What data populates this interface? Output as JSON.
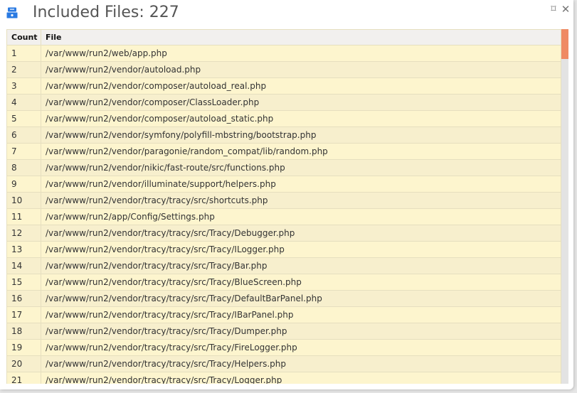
{
  "panel": {
    "title": "Included Files: 227",
    "icon": "file-cabinet-icon",
    "controls": {
      "window": {
        "icon": "detach-window-icon",
        "glyph": "⌑"
      },
      "close": {
        "icon": "close-icon",
        "glyph": "✕"
      }
    }
  },
  "table": {
    "headers": [
      "Count",
      "File"
    ],
    "rows": [
      {
        "count": "1",
        "file": "/var/www/run2/web/app.php"
      },
      {
        "count": "2",
        "file": "/var/www/run2/vendor/autoload.php"
      },
      {
        "count": "3",
        "file": "/var/www/run2/vendor/composer/autoload_real.php"
      },
      {
        "count": "4",
        "file": "/var/www/run2/vendor/composer/ClassLoader.php"
      },
      {
        "count": "5",
        "file": "/var/www/run2/vendor/composer/autoload_static.php"
      },
      {
        "count": "6",
        "file": "/var/www/run2/vendor/symfony/polyfill-mbstring/bootstrap.php"
      },
      {
        "count": "7",
        "file": "/var/www/run2/vendor/paragonie/random_compat/lib/random.php"
      },
      {
        "count": "8",
        "file": "/var/www/run2/vendor/nikic/fast-route/src/functions.php"
      },
      {
        "count": "9",
        "file": "/var/www/run2/vendor/illuminate/support/helpers.php"
      },
      {
        "count": "10",
        "file": "/var/www/run2/vendor/tracy/tracy/src/shortcuts.php"
      },
      {
        "count": "11",
        "file": "/var/www/run2/app/Config/Settings.php"
      },
      {
        "count": "12",
        "file": "/var/www/run2/vendor/tracy/tracy/src/Tracy/Debugger.php"
      },
      {
        "count": "13",
        "file": "/var/www/run2/vendor/tracy/tracy/src/Tracy/ILogger.php"
      },
      {
        "count": "14",
        "file": "/var/www/run2/vendor/tracy/tracy/src/Tracy/Bar.php"
      },
      {
        "count": "15",
        "file": "/var/www/run2/vendor/tracy/tracy/src/Tracy/BlueScreen.php"
      },
      {
        "count": "16",
        "file": "/var/www/run2/vendor/tracy/tracy/src/Tracy/DefaultBarPanel.php"
      },
      {
        "count": "17",
        "file": "/var/www/run2/vendor/tracy/tracy/src/Tracy/IBarPanel.php"
      },
      {
        "count": "18",
        "file": "/var/www/run2/vendor/tracy/tracy/src/Tracy/Dumper.php"
      },
      {
        "count": "19",
        "file": "/var/www/run2/vendor/tracy/tracy/src/Tracy/FireLogger.php"
      },
      {
        "count": "20",
        "file": "/var/www/run2/vendor/tracy/tracy/src/Tracy/Helpers.php"
      },
      {
        "count": "21",
        "file": "/var/www/run2/vendor/tracy/tracy/src/Tracy/Logger.php"
      }
    ]
  },
  "scrollbar": {
    "position_fraction": 0.0,
    "visible_fraction": 0.085
  },
  "colors": {
    "icon": "#2a7ae2",
    "scroll_thumb": "#ef8a63",
    "row_odd": "#fdf5ce",
    "row_even": "#f7efcd",
    "header_bg": "#f2f0ee"
  }
}
